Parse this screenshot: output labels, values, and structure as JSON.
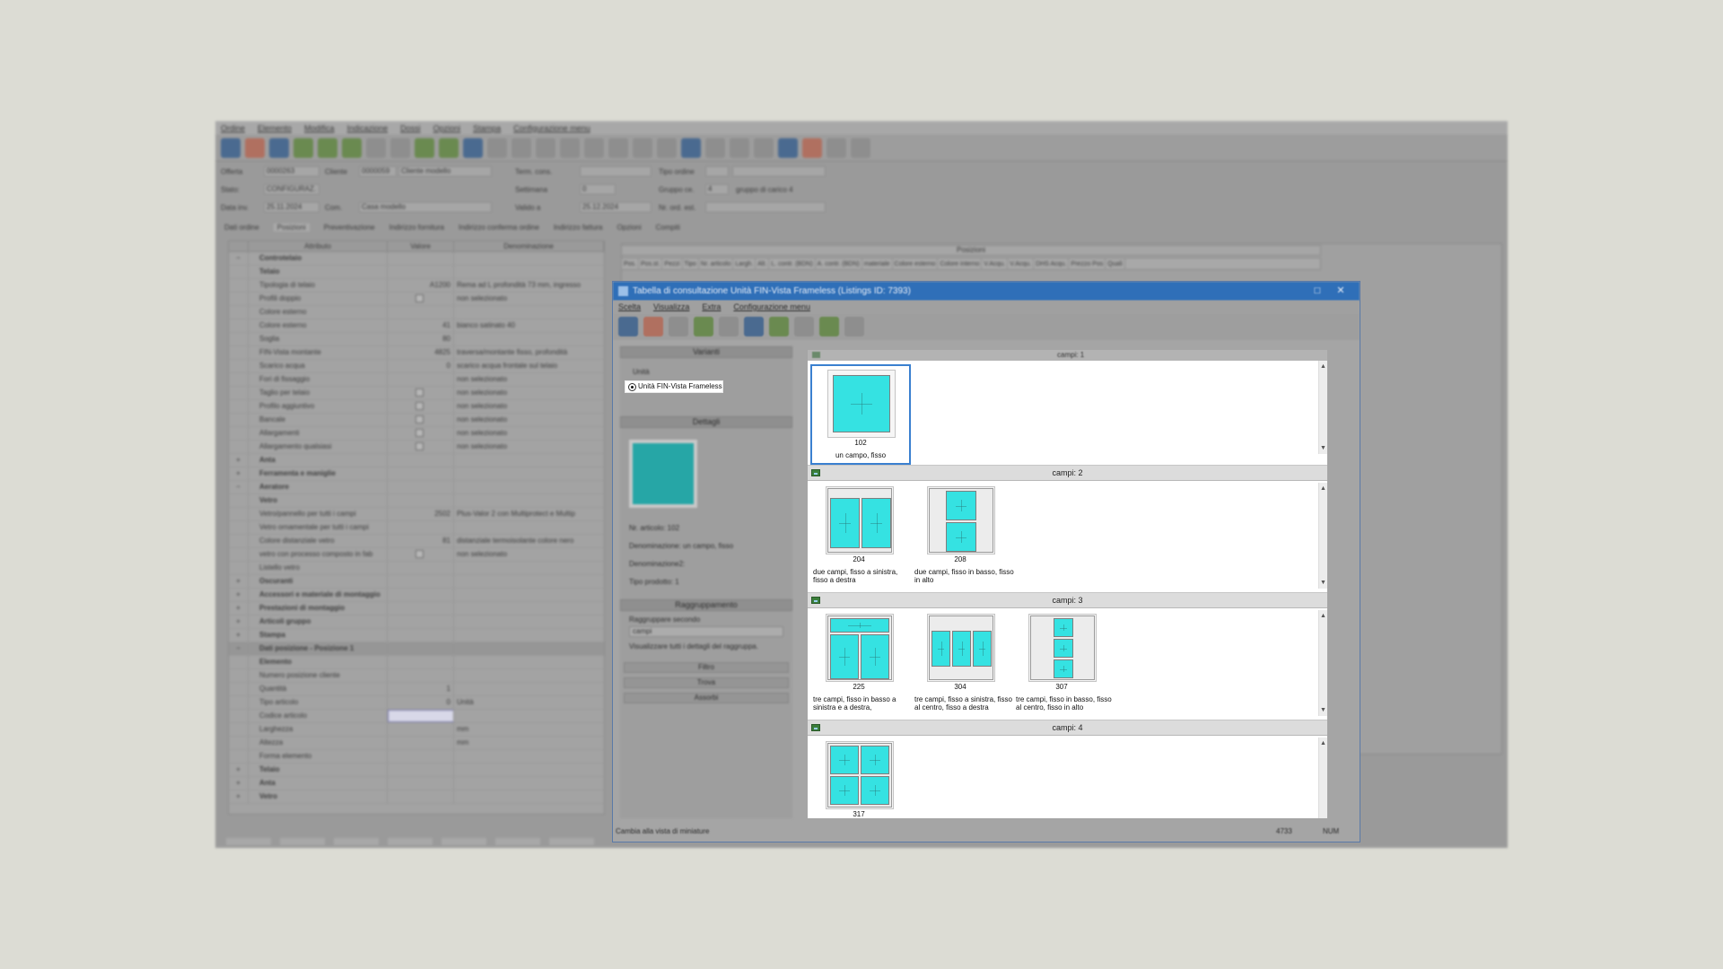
{
  "background_app": {
    "menu": [
      "Ordine",
      "Elemento",
      "Modifica",
      "Indicazione",
      "Dossi",
      "Opzioni",
      "Stampa",
      "Configurazione menu"
    ],
    "form": {
      "offerta_label": "Offerta",
      "offerta_value": "0000263",
      "cliente_label": "Cliente",
      "cliente_code": "0000059",
      "cliente_value": "Cliente modello",
      "stato_label": "Stato:",
      "stato_value": "CONFIGURAZ.",
      "data_label": "Data inv.",
      "data_value": "25.11.2024",
      "com_label": "Com.",
      "com_value": "Casa modello",
      "term_cons_label": "Term. cons.",
      "settimana_label": "Settimana",
      "settimana_value": "0",
      "valido_label": "Valido a",
      "valido_value": "25.12.2024",
      "tipo_ordine_label": "Tipo ordine",
      "gruppo_label": "Gruppo ce.",
      "gruppo_value": "4",
      "gruppo_text": "gruppo di carico 4",
      "nr_ord_label": "Nr. ord. est."
    },
    "tabs": [
      "Dati ordine",
      "Posizioni",
      "Preventivazione",
      "Indirizzo fornitura",
      "Indirizzo conferma ordine",
      "Indirizzo fattura",
      "Opzioni",
      "Compiti"
    ],
    "grid_headers": [
      "Attributo",
      "Valore",
      "Denominazione"
    ],
    "grid_rows": [
      {
        "mark": "−",
        "attr": "Controtelaio",
        "val": "",
        "den": "",
        "bold": true
      },
      {
        "mark": "",
        "attr": "Telaio",
        "val": "",
        "den": "",
        "bold": true
      },
      {
        "mark": "",
        "attr": "Tipologia di telaio",
        "val": "A1200",
        "den": "Rema ad L profondità 73 mm, ingresso"
      },
      {
        "mark": "",
        "attr": "Profili doppio",
        "val": "",
        "den": "non selezionato",
        "check": true
      },
      {
        "mark": "",
        "attr": "Colore esterno",
        "val": "",
        "den": ""
      },
      {
        "mark": "",
        "attr": "Colore esterno",
        "val": "41",
        "den": "bianco satinato 40"
      },
      {
        "mark": "",
        "attr": "Soglia",
        "val": "80",
        "den": ""
      },
      {
        "mark": "",
        "attr": "FIN-Vista montante",
        "val": "4825",
        "den": "traversa/montante fisso, profondità"
      },
      {
        "mark": "",
        "attr": "Scarico acqua",
        "val": "0",
        "den": "scarico acqua frontale sul telaio"
      },
      {
        "mark": "",
        "attr": "Fori di fissaggio",
        "val": "",
        "den": "non selezionato"
      },
      {
        "mark": "",
        "attr": "Taglio per telaio",
        "val": "",
        "den": "non selezionato",
        "check": true
      },
      {
        "mark": "",
        "attr": "Profilo aggiuntivo",
        "val": "",
        "den": "non selezionato",
        "check": true
      },
      {
        "mark": "",
        "attr": "Bancale",
        "val": "",
        "den": "non selezionato",
        "check": true
      },
      {
        "mark": "",
        "attr": "Allargamenti",
        "val": "",
        "den": "non selezionato",
        "check": true
      },
      {
        "mark": "",
        "attr": "Allargamento qualsiasi",
        "val": "",
        "den": "non selezionato",
        "check": true
      },
      {
        "mark": "+",
        "attr": "Anta",
        "val": "",
        "den": "",
        "bold": true
      },
      {
        "mark": "+",
        "attr": "Ferramenta e maniglie",
        "val": "",
        "den": "",
        "bold": true
      },
      {
        "mark": "−",
        "attr": "Aeratore",
        "val": "",
        "den": "",
        "bold": true
      },
      {
        "mark": "",
        "attr": "Vetro",
        "val": "",
        "den": "",
        "bold": true
      },
      {
        "mark": "",
        "attr": "Vetro/pannello per tutti i campi",
        "val": "2502",
        "den": "Plus-Valor 2 con Multiprotect e Multip"
      },
      {
        "mark": "",
        "attr": "Vetro ornamentale per tutti i campi",
        "val": "",
        "den": ""
      },
      {
        "mark": "",
        "attr": "Colore distanziale vetro",
        "val": "81",
        "den": "distanziale termoisolante colore nero"
      },
      {
        "mark": "",
        "attr": "vetro con processo composto in fab",
        "val": "",
        "den": "non selezionato",
        "check": true
      },
      {
        "mark": "",
        "attr": "Listello vetro",
        "val": "",
        "den": ""
      },
      {
        "mark": "+",
        "attr": "Oscuranti",
        "val": "",
        "den": "",
        "bold": true
      },
      {
        "mark": "+",
        "attr": "Accessori e materiale di montaggio",
        "val": "",
        "den": "",
        "bold": true
      },
      {
        "mark": "+",
        "attr": "Prestazioni di montaggio",
        "val": "",
        "den": "",
        "bold": true
      },
      {
        "mark": "+",
        "attr": "Articoli gruppo",
        "val": "",
        "den": "",
        "bold": true
      },
      {
        "mark": "+",
        "attr": "Stampa",
        "val": "",
        "den": "",
        "bold": true
      },
      {
        "mark": "−",
        "attr": "Dati posizione - Posizione 1",
        "val": "",
        "den": "",
        "bold": true,
        "sect": true
      },
      {
        "mark": "",
        "attr": "Elemento",
        "val": "",
        "den": "",
        "bold": true
      },
      {
        "mark": "",
        "attr": "Numero posizione cliente",
        "val": "",
        "den": ""
      },
      {
        "mark": "",
        "attr": "Quantità",
        "val": "1",
        "den": ""
      },
      {
        "mark": "",
        "attr": "Tipo articolo",
        "val": "0",
        "den": "Unità"
      },
      {
        "mark": "",
        "attr": "Codice articolo",
        "val": "",
        "den": "",
        "selected": true
      },
      {
        "mark": "",
        "attr": "Larghezza",
        "val": "",
        "den": "mm"
      },
      {
        "mark": "",
        "attr": "Altezza",
        "val": "",
        "den": "mm"
      },
      {
        "mark": "",
        "attr": "Forma elemento",
        "val": "",
        "den": ""
      },
      {
        "mark": "+",
        "attr": "Telaio",
        "val": "",
        "den": "",
        "bold": true
      },
      {
        "mark": "+",
        "attr": "Anta",
        "val": "",
        "den": "",
        "bold": true
      },
      {
        "mark": "+",
        "attr": "Vetro",
        "val": "",
        "den": "",
        "bold": true
      }
    ],
    "positions_title": "Posizioni",
    "positions_columns": [
      "Pos.",
      "Pos.st.",
      "Pezzi",
      "Tipo",
      "Nr. articolo",
      "Largh.",
      "Alt.",
      "L. contr. (BDN)",
      "A. contr. (BDN)",
      "materiale",
      "Colore esterno",
      "Colore interno",
      "V.Acqu.",
      "V.Acqu.",
      "DHS Acqu.",
      "Prezzo Pos",
      "Quali"
    ]
  },
  "dialog": {
    "title": "Tabella di consultazione Unità FIN-Vista Frameless (Listings ID: 7393)",
    "menu": [
      "Scelta",
      "Visualizza",
      "Extra",
      "Configurazione menu"
    ],
    "left": {
      "variants_header": "Varianti",
      "variant_prev": "Unità",
      "variant_selected": "Unità FIN-Vista Frameless",
      "details_header": "Dettagli",
      "detail_lines": [
        "Nr. articolo: 102",
        "Denominazione: un campo, fisso",
        "Denominazione2:",
        "Tipo prodotto: 1"
      ],
      "grouping_header": "Raggruppamento",
      "grouping_label": "Raggruppare secondo",
      "grouping_value": "campi",
      "grouping_check": "Visualizzare tutti i dettagli del raggruppa.",
      "filter_label": "Filtro",
      "search_label": "Trova",
      "sort_label": "Assorbi"
    },
    "status_left": "Cambia alla vista di miniature",
    "status_mid": "4733",
    "status_right": "NUM"
  },
  "gallery": {
    "top_group": "campi: 1",
    "groups": [
      {
        "label": "campi: 1",
        "items": [
          {
            "number": "102",
            "caption": "un campo, fisso"
          }
        ]
      },
      {
        "label": "campi: 2",
        "items": [
          {
            "number": "204",
            "caption": "due campi, fisso a sinistra, fisso a destra"
          },
          {
            "number": "208",
            "caption": "due campi, fisso in basso, fisso in alto"
          }
        ]
      },
      {
        "label": "campi: 3",
        "items": [
          {
            "number": "225",
            "caption": "tre campi, fisso in basso a sinistra e a destra,"
          },
          {
            "number": "304",
            "caption": "tre campi, fisso a sinistra, fisso al centro, fisso a destra"
          },
          {
            "number": "307",
            "caption": "tre campi, fisso in basso, fisso al centro, fisso in alto"
          }
        ]
      },
      {
        "label": "campi: 4",
        "items": [
          {
            "number": "317",
            "caption": ""
          }
        ]
      }
    ],
    "colors": {
      "glass": "#35e2e2",
      "frame": "#ececec",
      "selection": "#3a80d0"
    }
  }
}
